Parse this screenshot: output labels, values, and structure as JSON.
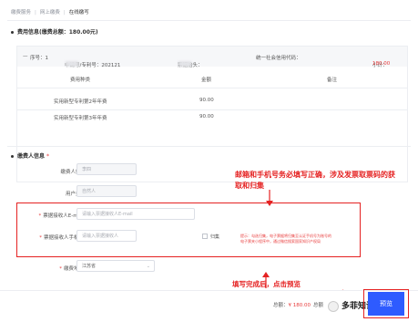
{
  "breadcrumb": [
    "缴费服务",
    "网上缴费",
    "在线缴写"
  ],
  "fee_info": {
    "title": "费用信息(缴费总额：180.00元)",
    "order": {
      "seq": "序号：1",
      "app_no": "申请号/专利号：202121",
      "invoice_header": "票据抬头：",
      "credit_code": "统一社会信用代码：",
      "subtotal_label": "小计：",
      "subtotal_value": "180.00"
    },
    "columns": [
      "费用种类",
      "金额",
      "备注"
    ],
    "rows": [
      {
        "type": "实用新型专利第2年年费",
        "amount": "90.00",
        "note": ""
      },
      {
        "type": "实用新型专利第3年年费",
        "amount": "90.00",
        "note": ""
      }
    ]
  },
  "payer_info": {
    "title": "缴费人信息",
    "name_label": "缴费人姓名",
    "name_value": "李四",
    "user_type_label": "用户类型",
    "user_type_value": "自然人",
    "email_label": "票据接收人E-mail",
    "email_placeholder": "请输入票据接收人E-mail",
    "phone_label": "票据接收人手机号",
    "phone_placeholder": "请输入票据接收人",
    "archive_label": "归集",
    "tip_line1": "提示：勾选归集，电子票据将归集至认证手机号为账号的",
    "tip_line2": "电子票夹小程序中，通过微信搜索国家知识产权局",
    "region_label": "缴费地区",
    "region_value": "江苏省"
  },
  "annotations": {
    "top": "邮箱和手机号务必填写正确，涉及发票取票码的获",
    "top2": "取和归集",
    "bottom": "填写完成后，点击预览"
  },
  "footer": {
    "total_label": "总额：",
    "total_value": "¥ 180.00",
    "total_suffix": "总额",
    "preview_label": "预览"
  },
  "watermark": "多菲知识产权",
  "colors": {
    "accent_red": "#e52222",
    "primary_blue": "#2e5bff"
  }
}
